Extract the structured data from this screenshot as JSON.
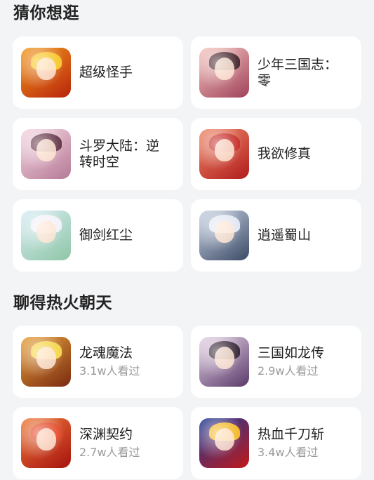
{
  "sections": [
    {
      "title": "猜你想逛",
      "items": [
        {
          "title": "超级怪手",
          "sub": "",
          "c1": "#f39a1c",
          "c2": "#b8240c",
          "hair": "#f7c21a"
        },
        {
          "title": "少年三国志：零",
          "sub": "",
          "c1": "#f5c7c0",
          "c2": "#a0425a",
          "hair": "#3a1a22"
        },
        {
          "title": "斗罗大陆：逆转时空",
          "sub": "",
          "c1": "#f6d6e2",
          "c2": "#b57a96",
          "hair": "#5a2a3c"
        },
        {
          "title": "我欲修真",
          "sub": "",
          "c1": "#f08a6a",
          "c2": "#b01c1c",
          "hair": "#c4231f"
        },
        {
          "title": "御剑红尘",
          "sub": "",
          "c1": "#d7ecf5",
          "c2": "#8fc6a6",
          "hair": "#f1f1f8"
        },
        {
          "title": "逍遥蜀山",
          "sub": "",
          "c1": "#c8d4e4",
          "c2": "#3c4a66",
          "hair": "#dfe6f2"
        }
      ]
    },
    {
      "title": "聊得热火朝天",
      "items": [
        {
          "title": "龙魂魔法",
          "sub": "3.1w人看过",
          "c1": "#e9a23a",
          "c2": "#7a2a10",
          "hair": "#f3d23c"
        },
        {
          "title": "三国如龙传",
          "sub": "2.9w人看过",
          "c1": "#e8d6e8",
          "c2": "#5a3a6a",
          "hair": "#2a1a2a"
        },
        {
          "title": "深渊契约",
          "sub": "2.7w人看过",
          "c1": "#f07a3a",
          "c2": "#a6120e",
          "hair": "#e23c1a"
        },
        {
          "title": "热血千刀斩",
          "sub": "3.4w人看过",
          "c1": "#1c3c9a",
          "c2": "#c01818",
          "hair": "#f2b51c"
        }
      ]
    }
  ]
}
